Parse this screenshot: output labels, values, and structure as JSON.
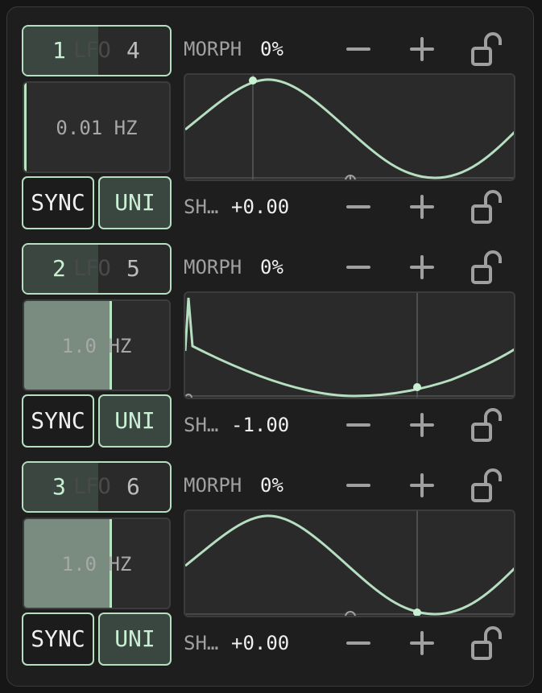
{
  "lfos": [
    {
      "selector": {
        "left": "1",
        "middle": "LFO",
        "right": "4"
      },
      "rate": {
        "text": "0.01 HZ",
        "level": 0.0
      },
      "sync_label": "SYNC",
      "uni_label": "UNI",
      "morph": {
        "label": "MORPH",
        "value": "0%"
      },
      "shape": {
        "label": "SH…",
        "value": "+0.00"
      },
      "icons": {
        "minus": "minus-icon",
        "plus": "plus-icon",
        "lock": "unlock-icon"
      }
    },
    {
      "selector": {
        "left": "2",
        "middle": "LFO",
        "right": "5"
      },
      "rate": {
        "text": "1.0 HZ",
        "level": 0.59
      },
      "sync_label": "SYNC",
      "uni_label": "UNI",
      "morph": {
        "label": "MORPH",
        "value": "0%"
      },
      "shape": {
        "label": "SH…",
        "value": "-1.00"
      },
      "icons": {
        "minus": "minus-icon",
        "plus": "plus-icon",
        "lock": "unlock-icon"
      }
    },
    {
      "selector": {
        "left": "3",
        "middle": "LFO",
        "right": "6"
      },
      "rate": {
        "text": "1.0 HZ",
        "level": 0.59
      },
      "sync_label": "SYNC",
      "uni_label": "UNI",
      "morph": {
        "label": "MORPH",
        "value": "0%"
      },
      "shape": {
        "label": "SH…",
        "value": "+0.00"
      },
      "icons": {
        "minus": "minus-icon",
        "plus": "plus-icon",
        "lock": "unlock-icon"
      }
    }
  ],
  "colors": {
    "accent": "#b6dfc2",
    "background": "#1e1e1e",
    "plot": "#2a2a2a"
  }
}
